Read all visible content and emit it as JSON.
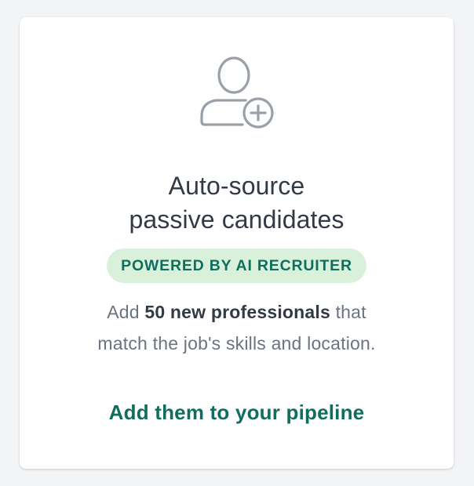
{
  "card": {
    "icon": "user-add-icon",
    "title_line1": "Auto-source",
    "title_line2": "passive candidates",
    "badge_label": "POWERED BY AI RECRUITER",
    "description": {
      "prefix": "Add ",
      "highlight": "50 new professionals",
      "suffix_line1": " that",
      "line2": "match the job's skills and location."
    },
    "cta_label": "Add them to your pipeline"
  },
  "colors": {
    "accent": "#0f6e5e",
    "badge_bg": "#d9f1da",
    "title": "#323a45",
    "body_text": "#6b7280",
    "icon": "#9aa0a8"
  }
}
